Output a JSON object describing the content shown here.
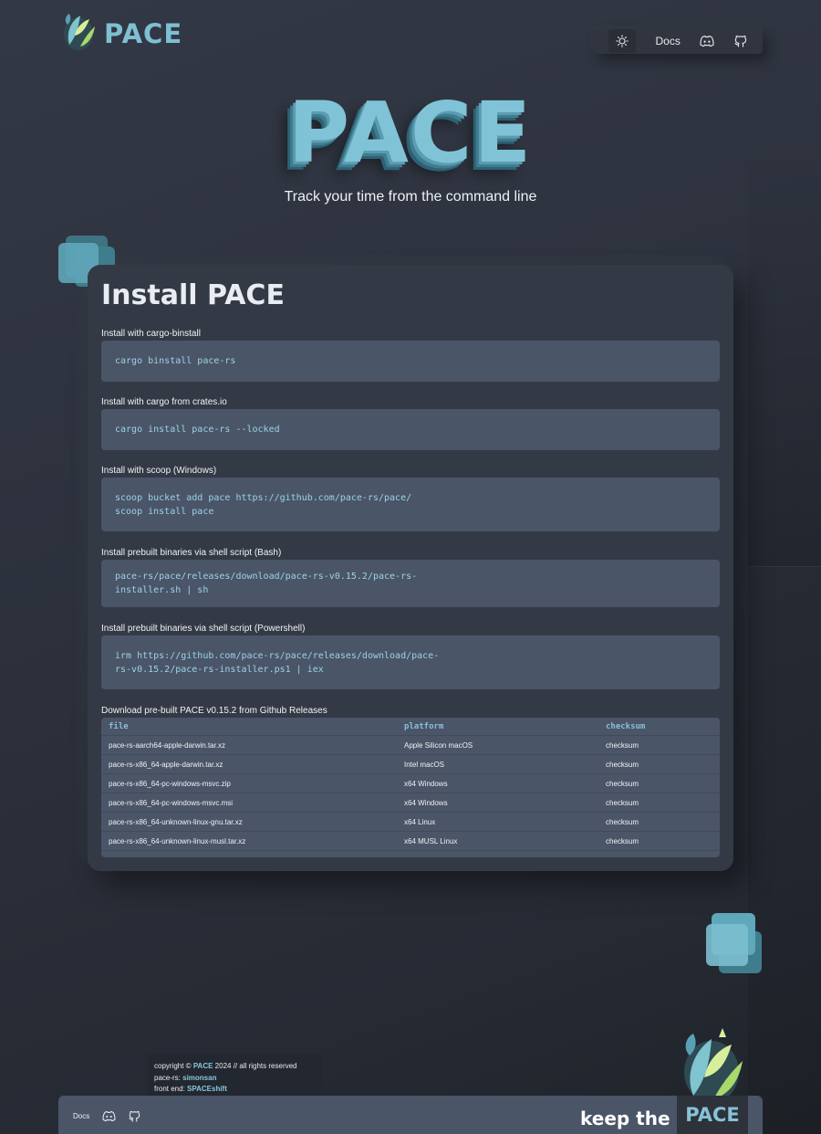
{
  "header": {
    "logo_text": "PACE",
    "nav": {
      "docs_label": "Docs"
    }
  },
  "hero": {
    "title": "PACE",
    "subtitle": "Track your time from the command line"
  },
  "install": {
    "title": "Install PACE",
    "sections": [
      {
        "label": "Install with cargo-binstall",
        "code": [
          "cargo binstall pace-rs"
        ]
      },
      {
        "label": "Install with cargo from crates.io",
        "code": [
          "cargo install pace-rs --locked"
        ]
      },
      {
        "label": "Install with scoop (Windows)",
        "code": [
          "scoop bucket add pace https://github.com/pace-rs/pace/",
          "scoop install pace"
        ]
      },
      {
        "label": "Install prebuilt binaries via shell script (Bash)",
        "code": [
          "pace-rs/pace/releases/download/pace-rs-v0.15.2/pace-rs-",
          "installer.sh | sh"
        ]
      },
      {
        "label": "Install prebuilt binaries via shell script (Powershell)",
        "code": [
          "irm https://github.com/pace-rs/pace/releases/download/pace-",
          "rs-v0.15.2/pace-rs-installer.ps1 | iex"
        ]
      }
    ],
    "downloads": {
      "label": "Download pre-built PACE v0.15.2 from Github Releases",
      "headers": [
        "file",
        "platform",
        "checksum"
      ],
      "rows": [
        [
          "pace-rs-aarch64-apple-darwin.tar.xz",
          "Apple Silicon macOS",
          "checksum"
        ],
        [
          "pace-rs-x86_64-apple-darwin.tar.xz",
          "Intel macOS",
          "checksum"
        ],
        [
          "pace-rs-x86_64-pc-windows-msvc.zip",
          "x64 Windows",
          "checksum"
        ],
        [
          "pace-rs-x86_64-pc-windows-msvc.msi",
          "x64 Windows",
          "checksum"
        ],
        [
          "pace-rs-x86_64-unknown-linux-gnu.tar.xz",
          "x64 Linux",
          "checksum"
        ],
        [
          "pace-rs-x86_64-unknown-linux-musl.tar.xz",
          "x64 MUSL Linux",
          "checksum"
        ]
      ]
    }
  },
  "footer": {
    "copyright": {
      "prefix": "copyright © ",
      "brand": "PACE",
      "suffix": " 2024 // all rights reserved",
      "pace_rs_label": "pace-rs: ",
      "pace_rs_author": "simonsan",
      "frontend_label": "front end: ",
      "frontend_author": "SPACEshift"
    },
    "docs_label": "Docs",
    "keep_text": "keep the",
    "keep_brand": "PACE"
  },
  "colors": {
    "accent": "#80c3d6",
    "background": "#2c313c",
    "card": "#343a45",
    "code_block": "#4b5568"
  },
  "icons": [
    "sun-icon",
    "discord-icon",
    "github-icon",
    "leaf-logo-icon"
  ]
}
